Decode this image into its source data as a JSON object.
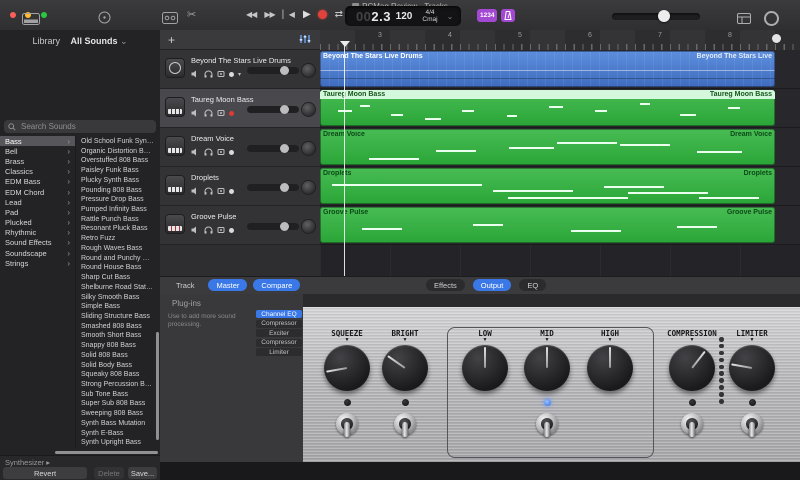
{
  "window": {
    "title": "PCMag Review - Tracks"
  },
  "toolbar": {
    "lcd": {
      "ghost": "00",
      "position": "2.3",
      "tempo": "120",
      "signature": "4/4",
      "key": "Cmaj"
    },
    "count_in_label": "1234"
  },
  "library": {
    "header_label": "Library",
    "collection_label": "All Sounds",
    "search_placeholder": "Search Sounds",
    "categories": [
      "Bass",
      "Bell",
      "Brass",
      "Classics",
      "EDM Bass",
      "EDM Chord",
      "Lead",
      "Pad",
      "Plucked",
      "Rhythmic",
      "Sound Effects",
      "Soundscape",
      "Strings"
    ],
    "sounds": [
      "Old School Funk Synth B...",
      "Organic Distortion Bass",
      "Overstuffed 808 Bass",
      "Paisley Funk Bass",
      "Plucky Synth Bass",
      "Pounding 808 Bass",
      "Pressure Drop Bass",
      "Pumped Infinity Bass",
      "Rattle Punch Bass",
      "Resonant Pluck Bass",
      "Retro Fuzz",
      "Rough Waves Bass",
      "Round and Punchy Bass",
      "Round House Bass",
      "Sharp Cut Bass",
      "Shelburne Road State Ba...",
      "Silky Smooth Bass",
      "Simple Bass",
      "Sliding Structure Bass",
      "Smashed 808 Bass",
      "Smooth Short Bass",
      "Snappy 808 Bass",
      "Solid 808 Bass",
      "Solid Body Bass",
      "Squeaky 808 Bass",
      "Strong Percussion Bass",
      "Sub Tone Bass",
      "Super Sub 808 Bass",
      "Sweeping 808 Bass",
      "Synth Bass Mutation",
      "Synth E-Bass",
      "Synth Upright Bass"
    ],
    "instrument_label": "Synthesizer",
    "revert_label": "Revert",
    "delete_label": "Delete",
    "save_label": "Save..."
  },
  "tracks": [
    {
      "name": "Beyond The Stars Live Drums"
    },
    {
      "name": "Taureg Moon Bass"
    },
    {
      "name": "Dream Voice"
    },
    {
      "name": "Droplets"
    },
    {
      "name": "Groove Pulse"
    }
  ],
  "ruler": {
    "numbers": [
      "3",
      "4",
      "5",
      "6",
      "7",
      "8"
    ]
  },
  "regions": [
    {
      "name": "Beyond The Stars Live Drums",
      "right_label": "Beyond The Stars Live"
    },
    {
      "name": "Taureg Moon Bass",
      "right_label": "Taureg Moon Bass"
    },
    {
      "name": "Dream Voice",
      "right_label": "Dream Voice"
    },
    {
      "name": "Droplets",
      "right_label": "Droplets"
    },
    {
      "name": "Groove Pulse",
      "right_label": "Groove Pulse"
    }
  ],
  "master": {
    "tabs": [
      "Track",
      "Master",
      "Compare"
    ],
    "view_tabs": [
      "Effects",
      "Output",
      "EQ"
    ],
    "plugins_title": "Plug-ins",
    "plugins_hint": "Use to add more sound processing.",
    "plugins": [
      "Channel EQ",
      "Compressor",
      "Exciter",
      "Compressor",
      "Limiter"
    ],
    "knobs": [
      "SQUEEZE",
      "BRIGHT",
      "LOW",
      "MID",
      "HIGH",
      "COMPRESSION",
      "LIMITER"
    ]
  },
  "colors": {
    "accent_blue": "#3a78e8",
    "badge_purple": "#a348d2",
    "region_green": "#2eb33c",
    "region_blue": "#4a77c8",
    "record_red": "#e03a36"
  }
}
